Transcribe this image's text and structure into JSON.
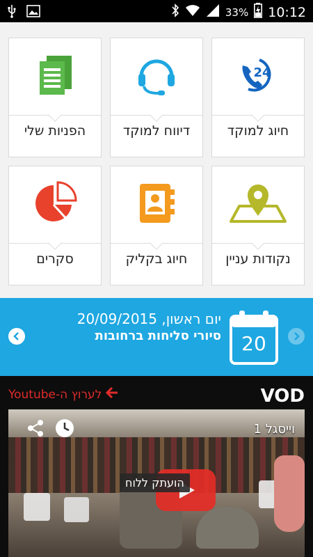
{
  "status_bar": {
    "battery_percent": "33%",
    "time": "10:12",
    "icons": [
      "usb-icon",
      "image-icon",
      "bluetooth-icon",
      "wifi-icon",
      "signal-icon",
      "battery-charging-icon"
    ]
  },
  "tiles": [
    {
      "label": "חיוג למוקד",
      "icon": "phone-24-icon"
    },
    {
      "label": "דיווח למוקד",
      "icon": "headset-icon"
    },
    {
      "label": "הפניות שלי",
      "icon": "documents-icon"
    },
    {
      "label": "נקודות עניין",
      "icon": "map-pin-icon"
    },
    {
      "label": "חיוג בקליק",
      "icon": "contacts-book-icon"
    },
    {
      "label": "סקרים",
      "icon": "pie-chart-icon"
    }
  ],
  "banner": {
    "date_line": "יום ראשון, 20/09/2015",
    "event": "סיורי סליחות ברחובות",
    "calendar_day": "20",
    "background": "#1ea7e1"
  },
  "vod": {
    "title": "VOD",
    "youtube_link": "לערוץ ה-Youtube",
    "video_title": "וייסגל 1",
    "toast": "הועתק ללוח"
  },
  "colors": {
    "blue_icon": "#1565c0",
    "cyan_icon": "#1ea7e1",
    "green_icon": "#5cb94b",
    "olive_icon": "#b5b82a",
    "orange_icon": "#f39a1f",
    "red_icon": "#e8412c",
    "youtube_red": "#e02b2b"
  }
}
